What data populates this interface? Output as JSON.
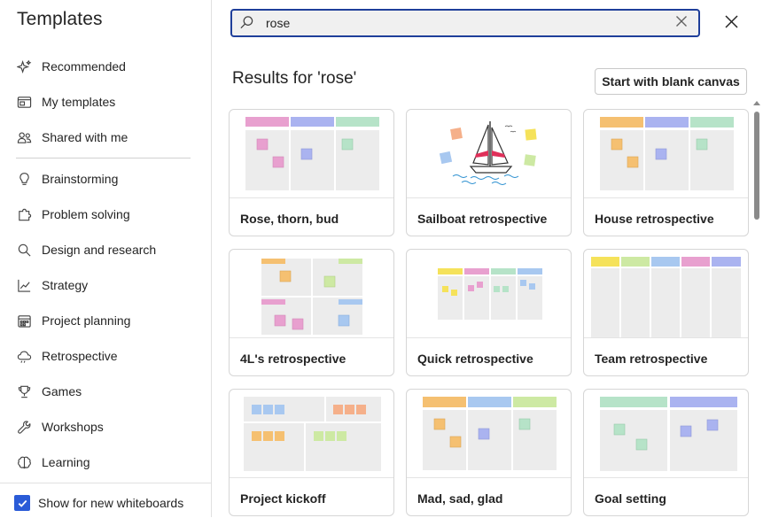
{
  "sidebar": {
    "title": "Templates",
    "items": [
      {
        "label": "Recommended",
        "icon": "sparkle-icon"
      },
      {
        "label": "My templates",
        "icon": "template-icon"
      },
      {
        "label": "Shared with me",
        "icon": "people-icon"
      },
      {
        "label": "Brainstorming",
        "icon": "lightbulb-icon"
      },
      {
        "label": "Problem solving",
        "icon": "puzzle-icon"
      },
      {
        "label": "Design and research",
        "icon": "search-icon"
      },
      {
        "label": "Strategy",
        "icon": "chart-icon"
      },
      {
        "label": "Project planning",
        "icon": "calendar-icon"
      },
      {
        "label": "Retrospective",
        "icon": "cloud-icon"
      },
      {
        "label": "Games",
        "icon": "trophy-icon"
      },
      {
        "label": "Workshops",
        "icon": "wrench-icon"
      },
      {
        "label": "Learning",
        "icon": "brain-icon"
      }
    ],
    "footer": {
      "label": "Show for new whiteboards",
      "checked": true
    }
  },
  "search": {
    "value": "rose",
    "placeholder": "Search"
  },
  "main": {
    "results_title": "Results for 'rose'",
    "blank_button": "Start with blank canvas",
    "cards": [
      {
        "label": "Rose, thorn, bud"
      },
      {
        "label": "Sailboat retrospective"
      },
      {
        "label": "House retrospective"
      },
      {
        "label": "4L's retrospective"
      },
      {
        "label": "Quick retrospective"
      },
      {
        "label": "Team retrospective"
      },
      {
        "label": "Project kickoff"
      },
      {
        "label": "Mad, sad, glad"
      },
      {
        "label": "Goal setting"
      }
    ]
  },
  "colors": {
    "accent": "#2a5bd7",
    "search_border": "#1f3f9a",
    "pink": "#e8a0cf",
    "purple": "#aab3f0",
    "green": "#b6e3c8",
    "orange": "#f5c071",
    "blue": "#a8c8f0",
    "lime": "#cde9a3"
  }
}
